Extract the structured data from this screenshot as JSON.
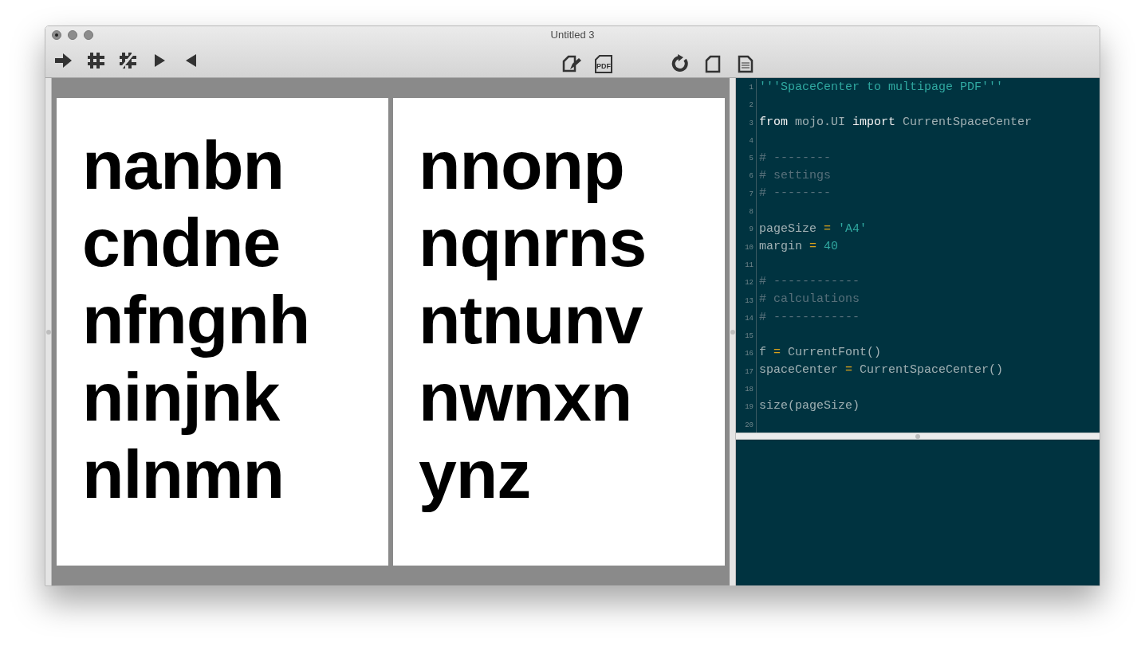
{
  "window": {
    "title": "Untitled 3"
  },
  "toolbar": {
    "left": [
      {
        "kind": "arrow-right"
      },
      {
        "kind": "hash"
      },
      {
        "kind": "hash-slash"
      },
      {
        "kind": "play"
      },
      {
        "kind": "play-back"
      }
    ],
    "center": [
      {
        "kind": "doc-edit"
      },
      {
        "kind": "doc-pdf",
        "icon_label": "PDF"
      },
      {
        "kind": "gap"
      },
      {
        "kind": "refresh"
      },
      {
        "kind": "doc-blank"
      },
      {
        "kind": "doc-lines"
      }
    ]
  },
  "preview": {
    "pages": [
      {
        "lines": [
          "nanbn",
          "cndne",
          "nfngnh",
          "ninjnk",
          "nlnmn"
        ]
      },
      {
        "lines": [
          "nnonp",
          "nqnrns",
          "ntnunv",
          "nwnxn",
          "ynz"
        ]
      }
    ]
  },
  "editor": {
    "lines": [
      {
        "number": "1",
        "tokens": [
          {
            "kind": "string",
            "text": "'''SpaceCenter to multipage PDF'''"
          }
        ]
      },
      {
        "number": "2"
      },
      {
        "number": "3",
        "tokens": [
          {
            "kind": "keyword",
            "text": "from"
          },
          {
            "kind": "plain",
            "text": " mojo.UI "
          },
          {
            "kind": "keyword",
            "text": "import"
          },
          {
            "kind": "plain",
            "text": " CurrentSpaceCenter"
          }
        ]
      },
      {
        "number": "4"
      },
      {
        "number": "5",
        "tokens": [
          {
            "kind": "comment",
            "text": "# --------"
          }
        ]
      },
      {
        "number": "6",
        "tokens": [
          {
            "kind": "comment",
            "text": "# settings"
          }
        ]
      },
      {
        "number": "7",
        "tokens": [
          {
            "kind": "comment",
            "text": "# --------"
          }
        ]
      },
      {
        "number": "8"
      },
      {
        "number": "9",
        "tokens": [
          {
            "kind": "plain",
            "text": "pageSize "
          },
          {
            "kind": "operator",
            "text": "="
          },
          {
            "kind": "string",
            "text": " 'A4'"
          }
        ]
      },
      {
        "number": "10",
        "tokens": [
          {
            "kind": "plain",
            "text": "margin "
          },
          {
            "kind": "operator",
            "text": "="
          },
          {
            "kind": "number",
            "text": " 40"
          }
        ]
      },
      {
        "number": "11"
      },
      {
        "number": "12",
        "tokens": [
          {
            "kind": "comment",
            "text": "# ------------"
          }
        ]
      },
      {
        "number": "13",
        "tokens": [
          {
            "kind": "comment",
            "text": "# calculations"
          }
        ]
      },
      {
        "number": "14",
        "tokens": [
          {
            "kind": "comment",
            "text": "# ------------"
          }
        ]
      },
      {
        "number": "15"
      },
      {
        "number": "16",
        "tokens": [
          {
            "kind": "plain",
            "text": "f "
          },
          {
            "kind": "operator",
            "text": "="
          },
          {
            "kind": "plain",
            "text": " CurrentFont()"
          }
        ]
      },
      {
        "number": "17",
        "tokens": [
          {
            "kind": "plain",
            "text": "spaceCenter "
          },
          {
            "kind": "operator",
            "text": "="
          },
          {
            "kind": "plain",
            "text": " CurrentSpaceCenter()"
          }
        ]
      },
      {
        "number": "18"
      },
      {
        "number": "19",
        "tokens": [
          {
            "kind": "plain",
            "text": "size(pageSize)"
          }
        ]
      },
      {
        "number": "20"
      }
    ]
  }
}
